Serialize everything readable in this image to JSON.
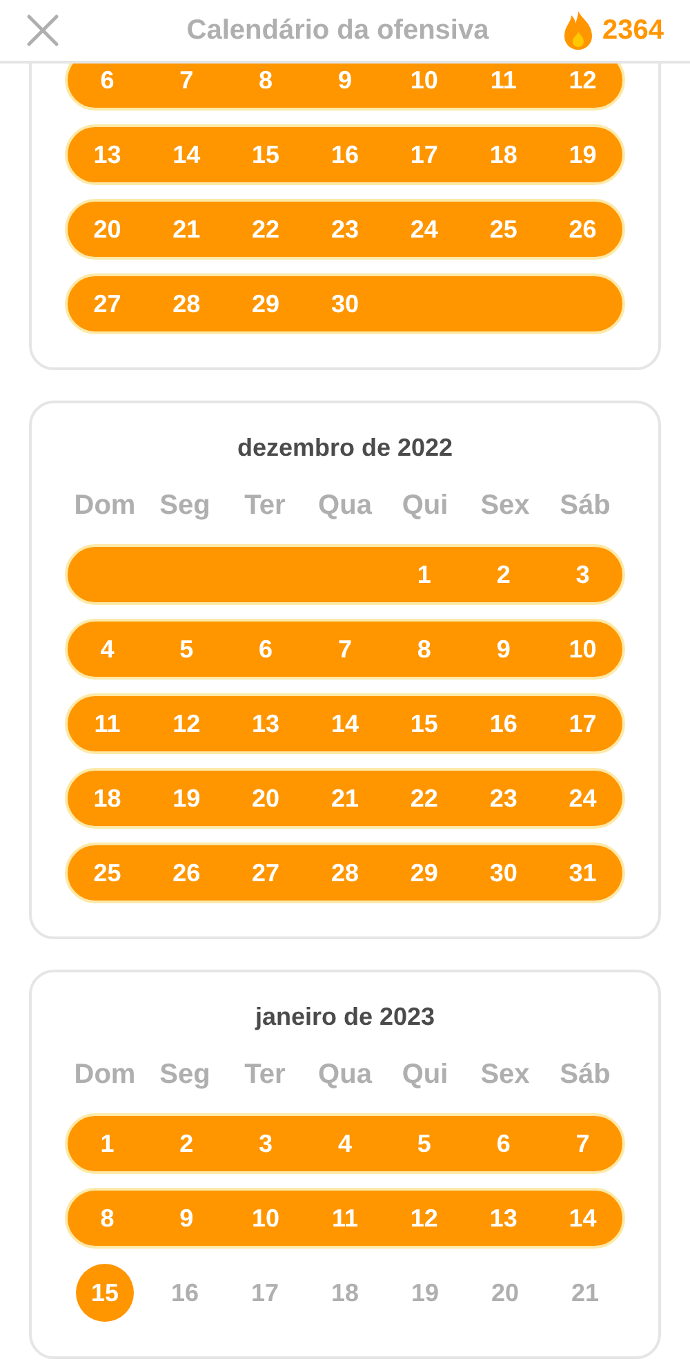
{
  "header": {
    "title": "Calendário da ofensiva",
    "streak_count": "2364"
  },
  "months": [
    {
      "weeks": [
        {
          "streak": true,
          "days": [
            {
              "label": "6",
              "selected": false
            },
            {
              "label": "7",
              "selected": false
            },
            {
              "label": "8",
              "selected": false
            },
            {
              "label": "9",
              "selected": false
            },
            {
              "label": "10",
              "selected": false
            },
            {
              "label": "11",
              "selected": false
            },
            {
              "label": "12",
              "selected": false
            }
          ]
        },
        {
          "streak": true,
          "days": [
            {
              "label": "13",
              "selected": false
            },
            {
              "label": "14",
              "selected": false
            },
            {
              "label": "15",
              "selected": false
            },
            {
              "label": "16",
              "selected": false
            },
            {
              "label": "17",
              "selected": false
            },
            {
              "label": "18",
              "selected": false
            },
            {
              "label": "19",
              "selected": false
            }
          ]
        },
        {
          "streak": true,
          "days": [
            {
              "label": "20",
              "selected": false
            },
            {
              "label": "21",
              "selected": false
            },
            {
              "label": "22",
              "selected": false
            },
            {
              "label": "23",
              "selected": false
            },
            {
              "label": "24",
              "selected": false
            },
            {
              "label": "25",
              "selected": false
            },
            {
              "label": "26",
              "selected": false
            }
          ]
        },
        {
          "streak": true,
          "days": [
            {
              "label": "27",
              "selected": false
            },
            {
              "label": "28",
              "selected": false
            },
            {
              "label": "29",
              "selected": false
            },
            {
              "label": "30",
              "selected": false
            }
          ]
        }
      ]
    },
    {
      "title": "dezembro de 2022",
      "weekdays": [
        "Dom",
        "Seg",
        "Ter",
        "Qua",
        "Qui",
        "Sex",
        "Sáb"
      ],
      "weeks": [
        {
          "streak": true,
          "days": [
            {
              "label": "1",
              "selected": false
            },
            {
              "label": "2",
              "selected": false
            },
            {
              "label": "3",
              "selected": false
            }
          ]
        },
        {
          "streak": true,
          "days": [
            {
              "label": "4",
              "selected": false
            },
            {
              "label": "5",
              "selected": false
            },
            {
              "label": "6",
              "selected": false
            },
            {
              "label": "7",
              "selected": false
            },
            {
              "label": "8",
              "selected": false
            },
            {
              "label": "9",
              "selected": false
            },
            {
              "label": "10",
              "selected": false
            }
          ]
        },
        {
          "streak": true,
          "days": [
            {
              "label": "11",
              "selected": false
            },
            {
              "label": "12",
              "selected": false
            },
            {
              "label": "13",
              "selected": false
            },
            {
              "label": "14",
              "selected": false
            },
            {
              "label": "15",
              "selected": false
            },
            {
              "label": "16",
              "selected": false
            },
            {
              "label": "17",
              "selected": false
            }
          ]
        },
        {
          "streak": true,
          "days": [
            {
              "label": "18",
              "selected": false
            },
            {
              "label": "19",
              "selected": false
            },
            {
              "label": "20",
              "selected": false
            },
            {
              "label": "21",
              "selected": false
            },
            {
              "label": "22",
              "selected": false
            },
            {
              "label": "23",
              "selected": false
            },
            {
              "label": "24",
              "selected": false
            }
          ]
        },
        {
          "streak": true,
          "days": [
            {
              "label": "25",
              "selected": false
            },
            {
              "label": "26",
              "selected": false
            },
            {
              "label": "27",
              "selected": false
            },
            {
              "label": "28",
              "selected": false
            },
            {
              "label": "29",
              "selected": false
            },
            {
              "label": "30",
              "selected": false
            },
            {
              "label": "31",
              "selected": false
            }
          ]
        }
      ]
    },
    {
      "title": "janeiro de 2023",
      "weekdays": [
        "Dom",
        "Seg",
        "Ter",
        "Qua",
        "Qui",
        "Sex",
        "Sáb"
      ],
      "weeks": [
        {
          "streak": true,
          "days": [
            {
              "label": "1",
              "selected": false
            },
            {
              "label": "2",
              "selected": false
            },
            {
              "label": "3",
              "selected": false
            },
            {
              "label": "4",
              "selected": false
            },
            {
              "label": "5",
              "selected": false
            },
            {
              "label": "6",
              "selected": false
            },
            {
              "label": "7",
              "selected": false
            }
          ]
        },
        {
          "streak": true,
          "days": [
            {
              "label": "8",
              "selected": false
            },
            {
              "label": "9",
              "selected": false
            },
            {
              "label": "10",
              "selected": false
            },
            {
              "label": "11",
              "selected": false
            },
            {
              "label": "12",
              "selected": false
            },
            {
              "label": "13",
              "selected": false
            },
            {
              "label": "14",
              "selected": false
            }
          ]
        },
        {
          "streak": false,
          "days": [
            {
              "label": "15",
              "selected": true
            },
            {
              "label": "16",
              "selected": false
            },
            {
              "label": "17",
              "selected": false
            },
            {
              "label": "18",
              "selected": false
            },
            {
              "label": "19",
              "selected": false
            },
            {
              "label": "20",
              "selected": false
            },
            {
              "label": "21",
              "selected": false
            }
          ]
        }
      ]
    }
  ]
}
